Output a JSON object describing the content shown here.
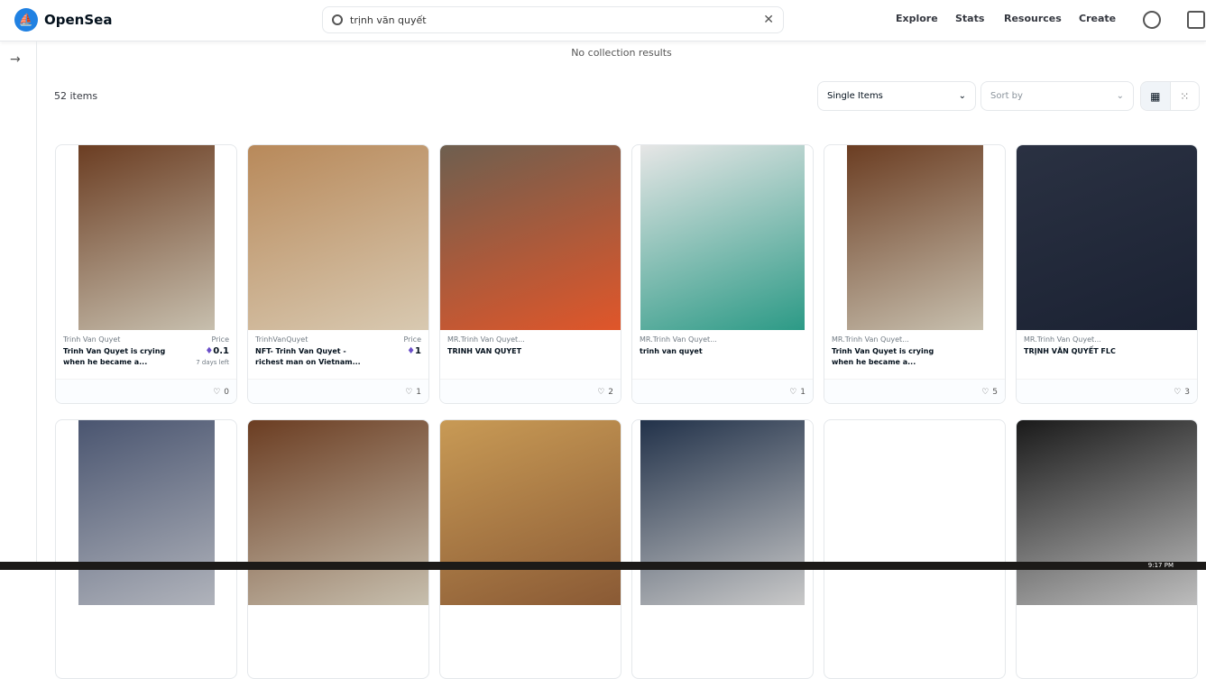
{
  "header": {
    "logo": "OpenSea",
    "search_value": "trịnh văn quyết",
    "nav": [
      "Explore",
      "Stats",
      "Resources",
      "Create"
    ]
  },
  "main": {
    "no_collection": "No collection results",
    "item_count": "52 items",
    "filter": "Single Items",
    "sort_placeholder": "Sort by"
  },
  "cards": [
    {
      "collection": "Trinh Van Quyet",
      "title": "Trinh Van Quyet is crying when he became a...",
      "price_label": "Price",
      "price": "0.1",
      "time": "7 days left",
      "likes": "0",
      "colors": [
        "#6b3d22",
        "#c7bfae"
      ]
    },
    {
      "collection": "TrinhVanQuyet",
      "title": "NFT- Trinh Van Quyet - richest man on Vietnam...",
      "price_label": "Price",
      "price": "1",
      "likes": "1",
      "colors": [
        "#b8895a",
        "#d8c9b1"
      ]
    },
    {
      "collection": "MR.Trinh Van Quyet...",
      "title": "TRINH VAN QUYET",
      "likes": "2",
      "colors": [
        "#6e5f4f",
        "#e0562a"
      ]
    },
    {
      "collection": "MR.Trinh Van Quyet...",
      "title": "trinh van quyet",
      "likes": "1",
      "colors": [
        "#e6e6e6",
        "#2c9a86"
      ]
    },
    {
      "collection": "MR.Trinh Van Quyet...",
      "title": "Trinh Van Quyet is crying when he became a...",
      "likes": "5",
      "colors": [
        "#6b3d22",
        "#c7bfae"
      ]
    },
    {
      "collection": "MR.Trinh Van Quyet...",
      "title": "TRỊNH VĂN QUYẾT FLC",
      "likes": "3",
      "colors": [
        "#2a3142",
        "#1b2233"
      ]
    },
    {
      "colors": [
        "#4a5570",
        "#b0b3bb"
      ]
    },
    {
      "colors": [
        "#6b3d22",
        "#c7bfae"
      ]
    },
    {
      "colors": [
        "#c89a55",
        "#8a5a35"
      ]
    },
    {
      "colors": [
        "#22324a",
        "#c9c9c9"
      ]
    },
    {
      "colors": [
        "#ffffff",
        "#ffffff"
      ]
    },
    {
      "colors": [
        "#1a1a1a",
        "#bdbdbd"
      ]
    }
  ],
  "taskbar": {
    "time": "9:17 PM"
  }
}
